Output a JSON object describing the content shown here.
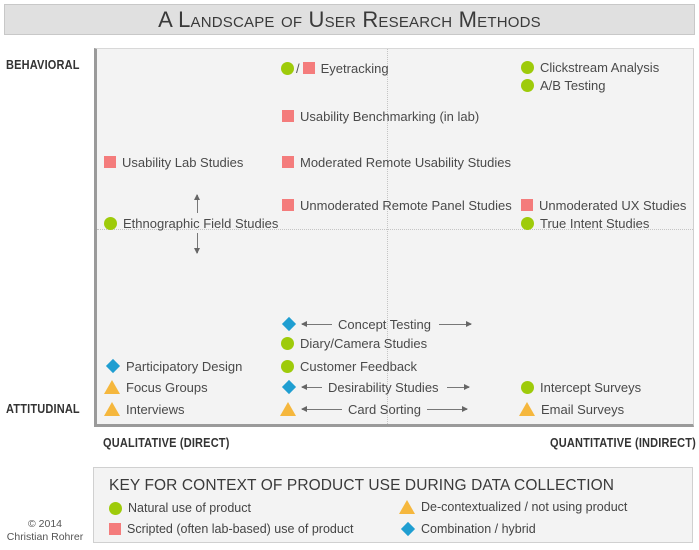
{
  "title": "A Landscape of User Research Methods",
  "axes": {
    "y_top": "BEHAVIORAL",
    "y_bottom": "ATTITUDINAL",
    "x_left": "QUALITATIVE (DIRECT)",
    "x_right": "QUANTITATIVE (INDIRECT)"
  },
  "legend_types": {
    "natural": {
      "shape": "circle",
      "color": "#9ecb0a"
    },
    "scripted": {
      "shape": "square",
      "color": "#f47c7c"
    },
    "decontextualized": {
      "shape": "triangle",
      "color": "#f5b73d"
    },
    "hybrid": {
      "shape": "diamond",
      "color": "#1f9ed1"
    }
  },
  "methods": [
    {
      "label": "Eyetracking",
      "types": [
        "natural",
        "scripted"
      ],
      "separator": "/"
    },
    {
      "label": "Clickstream Analysis",
      "types": [
        "natural"
      ]
    },
    {
      "label": "A/B Testing",
      "types": [
        "natural"
      ]
    },
    {
      "label": "Usability Benchmarking (in lab)",
      "types": [
        "scripted"
      ]
    },
    {
      "label": "Usability Lab Studies",
      "types": [
        "scripted"
      ]
    },
    {
      "label": "Moderated Remote Usability Studies",
      "types": [
        "scripted"
      ]
    },
    {
      "label": "Unmoderated Remote Panel Studies",
      "types": [
        "scripted"
      ]
    },
    {
      "label": "Unmoderated UX Studies",
      "types": [
        "scripted"
      ]
    },
    {
      "label": "Ethnographic Field Studies",
      "types": [
        "natural"
      ],
      "range": "vertical"
    },
    {
      "label": "True Intent Studies",
      "types": [
        "natural"
      ]
    },
    {
      "label": "Concept Testing",
      "types": [
        "hybrid"
      ],
      "range": "horizontal"
    },
    {
      "label": "Diary/Camera Studies",
      "types": [
        "natural"
      ]
    },
    {
      "label": "Participatory Design",
      "types": [
        "hybrid"
      ]
    },
    {
      "label": "Customer Feedback",
      "types": [
        "natural"
      ]
    },
    {
      "label": "Focus Groups",
      "types": [
        "decontextualized"
      ]
    },
    {
      "label": "Desirability Studies",
      "types": [
        "hybrid"
      ],
      "range": "horizontal"
    },
    {
      "label": "Intercept Surveys",
      "types": [
        "natural"
      ]
    },
    {
      "label": "Interviews",
      "types": [
        "decontextualized"
      ]
    },
    {
      "label": "Card Sorting",
      "types": [
        "decontextualized"
      ],
      "range": "horizontal"
    },
    {
      "label": "Email Surveys",
      "types": [
        "decontextualized"
      ]
    }
  ],
  "key": {
    "title": "KEY FOR CONTEXT OF PRODUCT USE DURING DATA COLLECTION",
    "items": [
      {
        "type": "natural",
        "label": "Natural use of product"
      },
      {
        "type": "scripted",
        "label": "Scripted (often lab-based) use of product"
      },
      {
        "type": "decontextualized",
        "label": "De-contextualized / not using product"
      },
      {
        "type": "hybrid",
        "label": "Combination / hybrid"
      }
    ]
  },
  "copyright": {
    "line1": "© 2014",
    "line2": "Christian Rohrer"
  }
}
